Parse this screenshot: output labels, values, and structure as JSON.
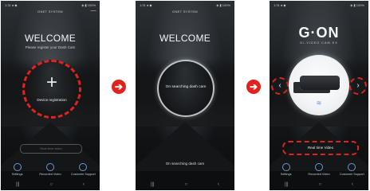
{
  "screens": [
    {
      "statusbar": {
        "time": "1:31 ● ◆",
        "icons": "◈ ▮ 100%"
      },
      "app_title": "GNET SYSTEM",
      "top_button": "—",
      "welcome": "WELCOME",
      "subtitle": "Please register your Dash Cam",
      "circle_label": "Device registration",
      "realtime_video": "Real time video",
      "nav": [
        "Settings",
        "Recorded Video",
        "Customer Support"
      ],
      "sys": [
        "|||",
        "○",
        "‹"
      ]
    },
    {
      "statusbar": {
        "time": "1:31 ● ◆",
        "icons": "◈ ▮ 100%"
      },
      "app_title": "GNET SYSTEM",
      "welcome": "WELCOME",
      "circle_text": "On searching dash cam",
      "bottom_text": "On searching dash cam",
      "sys": [
        "|||",
        "○",
        "‹"
      ]
    },
    {
      "statusbar": {
        "time": "1:31 ● ◆",
        "icons": "◈ ▮ 100%"
      },
      "logo": "G·ON",
      "logo_sub": "GI-VIDEO CAM EX",
      "arrow_left": "‹",
      "arrow_right": "›",
      "wifi_icon": "≋",
      "realtime_video": "Real time Video",
      "nav": [
        "Settings",
        "Recorded Video",
        "Customer Support"
      ],
      "sys": [
        "|||",
        "○",
        "‹"
      ]
    }
  ],
  "connectors": [
    "➔",
    "➔"
  ],
  "colors": {
    "accent_red": "#e0231f",
    "nav_blue": "#6f95d6"
  }
}
